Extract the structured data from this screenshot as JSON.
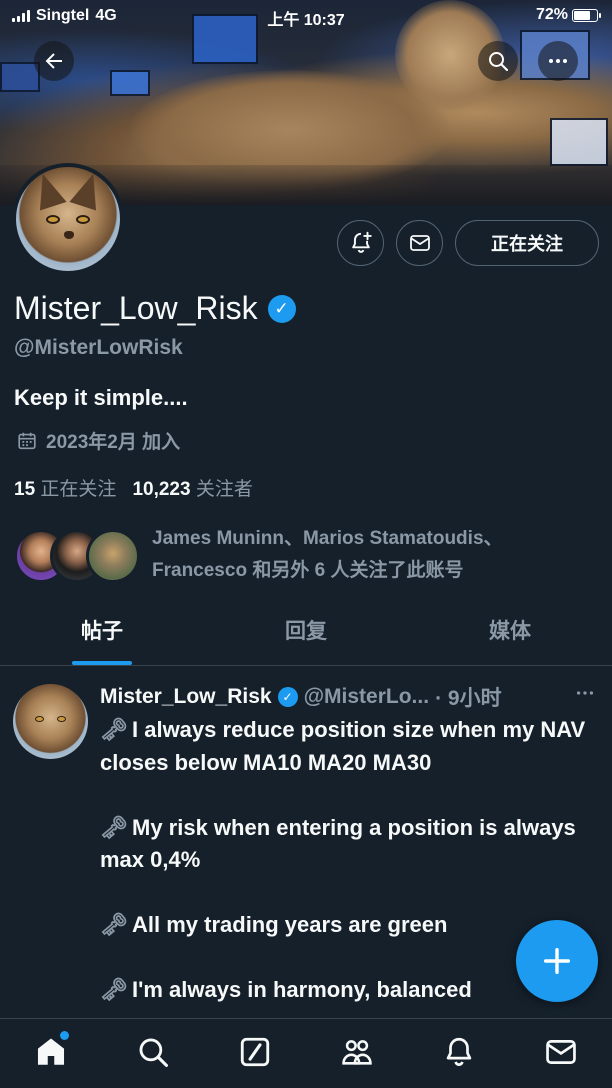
{
  "status_bar": {
    "carrier": "Singtel",
    "network": "4G",
    "time": "上午 10:37",
    "battery": "72%",
    "battery_level": 0.72
  },
  "profile": {
    "display_name": "Mister_Low_Risk",
    "handle": "@MisterLowRisk",
    "bio": "Keep it simple....",
    "joined": "2023年2月 加入",
    "following_count": "15",
    "following_label": "正在关注",
    "followers_count": "10,223",
    "followers_label": "关注者",
    "known_followers_line1": "James Muninn、Marios Stamatoudis、",
    "known_followers_line2": "Francesco 和另外 6 人关注了此账号"
  },
  "actions": {
    "follow_label": "正在关注"
  },
  "tabs": [
    {
      "label": "帖子",
      "active": true
    },
    {
      "label": "回复",
      "active": false
    },
    {
      "label": "媒体",
      "active": false
    }
  ],
  "post": {
    "name": "Mister_Low_Risk",
    "handle": "@MisterLo...",
    "time": "· 9小时",
    "lines": [
      "I always reduce position size when my NAV closes below MA10 MA20 MA30",
      "My risk when entering a position is always max 0,4%",
      "All my trading years are green",
      "I'm always in harmony, balanced"
    ]
  },
  "icons": {
    "back": "arrow-left-icon",
    "search": "search-icon",
    "more": "more-icon",
    "verified": "verified-badge-icon",
    "calendar": "calendar-icon",
    "key": "key-icon",
    "compose": "plus-icon"
  },
  "colors": {
    "background": "#15202b",
    "accent": "#1d9bf0",
    "secondary_text": "#8b98a5",
    "border": "#38444d"
  }
}
